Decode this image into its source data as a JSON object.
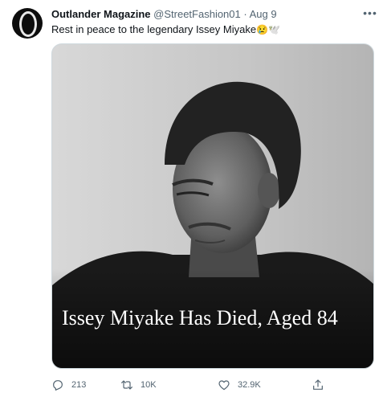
{
  "tweet": {
    "author": {
      "display_name": "Outlander Magazine",
      "handle": "@StreetFashion01",
      "separator": "·",
      "date": "Aug 9",
      "avatar_icon": "outlander-o-logo"
    },
    "more_icon": "more-horizontal-icon",
    "text": "Rest in peace to the legendary Issey Miyake",
    "text_emojis": [
      "😢",
      "🕊️"
    ],
    "media": {
      "description": "black and white portrait photo",
      "headline": "Issey Miyake Has Died, Aged 84"
    },
    "actions": {
      "replies": "213",
      "retweets": "10K",
      "likes": "32.9K",
      "reply_icon": "reply-icon",
      "retweet_icon": "retweet-icon",
      "like_icon": "heart-icon",
      "share_icon": "share-icon"
    }
  },
  "colors": {
    "text_primary": "#0f1419",
    "text_secondary": "#536471",
    "border": "#cfd9de"
  }
}
